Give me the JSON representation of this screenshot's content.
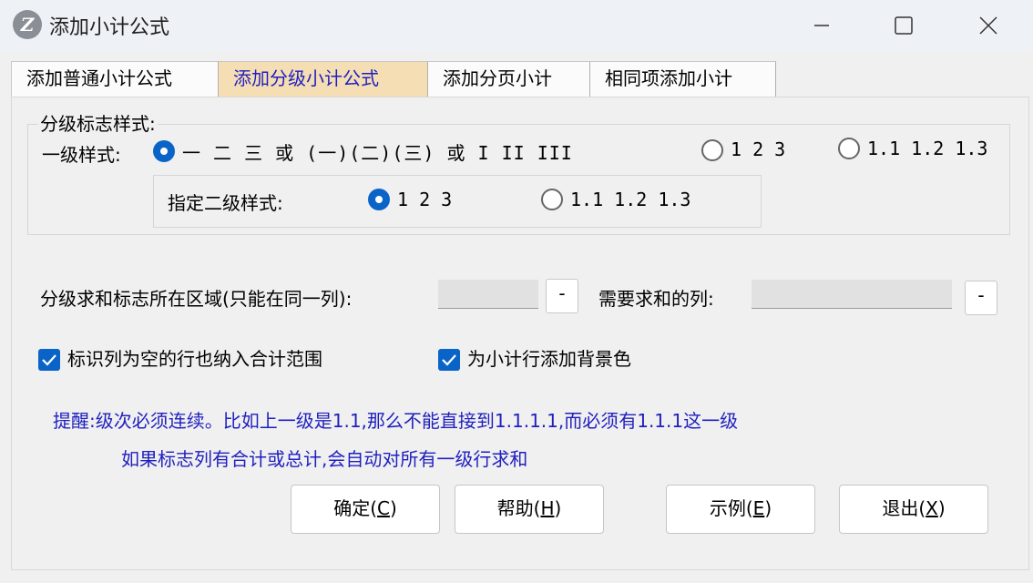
{
  "window": {
    "title": "添加小计公式",
    "app_icon": "Z",
    "controls": {
      "minimize_icon": "minimize-icon",
      "maximize_icon": "maximize-icon",
      "close_icon": "close-icon"
    }
  },
  "tabs": [
    {
      "label": "添加普通小计公式",
      "active": false
    },
    {
      "label": "添加分级小计公式",
      "active": true
    },
    {
      "label": "添加分页小计",
      "active": false
    },
    {
      "label": "相同项添加小计",
      "active": false
    }
  ],
  "group": {
    "legend": "分级标志样式:",
    "level1_label": "一级样式:",
    "level1_options": [
      {
        "text": "一 二 三  或 (一)(二)(三) 或 I II III",
        "selected": true
      },
      {
        "text": "1 2 3",
        "selected": false
      },
      {
        "text": "1.1 1.2 1.3",
        "selected": false
      }
    ],
    "level2_label": "指定二级样式:",
    "level2_options": [
      {
        "text": "1 2 3",
        "selected": true
      },
      {
        "text": "1.1 1.2 1.3",
        "selected": false
      }
    ]
  },
  "area": {
    "label": "分级求和标志所在区域(只能在同一列):",
    "value": "",
    "button": "-"
  },
  "sum_cols": {
    "label": "需要求和的列:",
    "value": "",
    "button": "-"
  },
  "checks": [
    {
      "label": "标识列为空的行也纳入合计范围",
      "checked": true
    },
    {
      "label": "为小计行添加背景色",
      "checked": true
    }
  ],
  "notes": {
    "line1": "提醒:级次必须连续。比如上一级是1.1,那么不能直接到1.1.1.1,而必须有1.1.1这一级",
    "line2": "如果标志列有合计或总计,会自动对所有一级行求和"
  },
  "buttons": {
    "ok": {
      "label": "确定(",
      "key": "C",
      "end": ")"
    },
    "help": {
      "label": "帮助(",
      "key": "H",
      "end": ")"
    },
    "example": {
      "label": "示例(",
      "key": "E",
      "end": ")"
    },
    "exit": {
      "label": "退出(",
      "key": "X",
      "end": ")"
    }
  },
  "colors": {
    "accent": "#0a64c8",
    "active_tab": "#f5deb3",
    "note_text": "#1f1fbf"
  }
}
